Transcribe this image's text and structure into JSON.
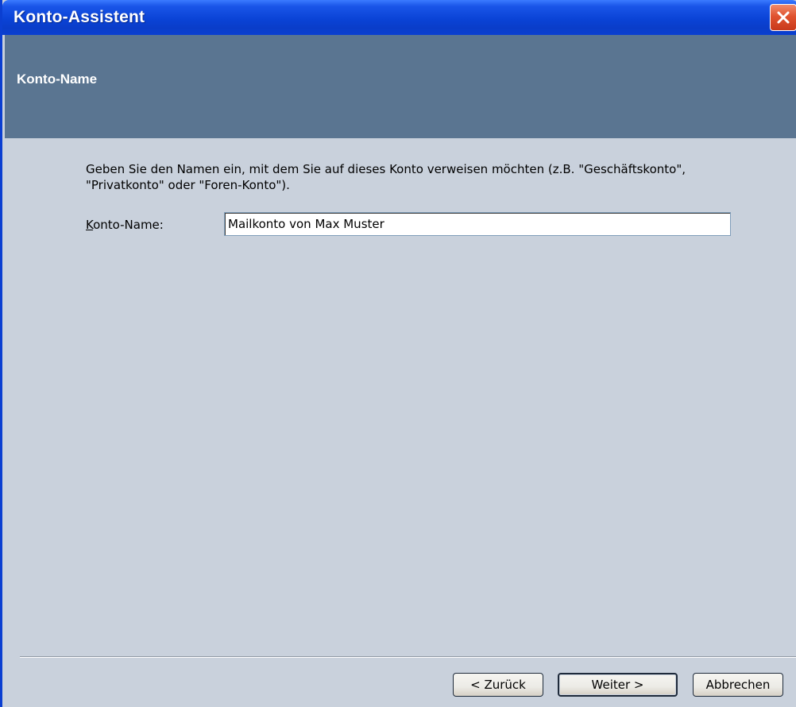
{
  "window": {
    "title": "Konto-Assistent",
    "close_icon": "close-icon",
    "accent_color": "#0a43d6",
    "close_color": "#e0532f"
  },
  "header": {
    "title": "Konto-Name",
    "background_color": "#5a7591"
  },
  "content": {
    "instructions": "Geben Sie den Namen ein, mit dem Sie auf dieses Konto verweisen möchten (z.B. \"Geschäftskonto\", \"Privatkonto\" oder \"Foren-Konto\").",
    "account_name_label_accel": "K",
    "account_name_label_rest": "onto-Name:",
    "account_name_value": "Mailkonto von Max Muster"
  },
  "footer": {
    "back_label": "< Zurück",
    "next_label": "Weiter >",
    "cancel_label": "Abbrechen"
  }
}
